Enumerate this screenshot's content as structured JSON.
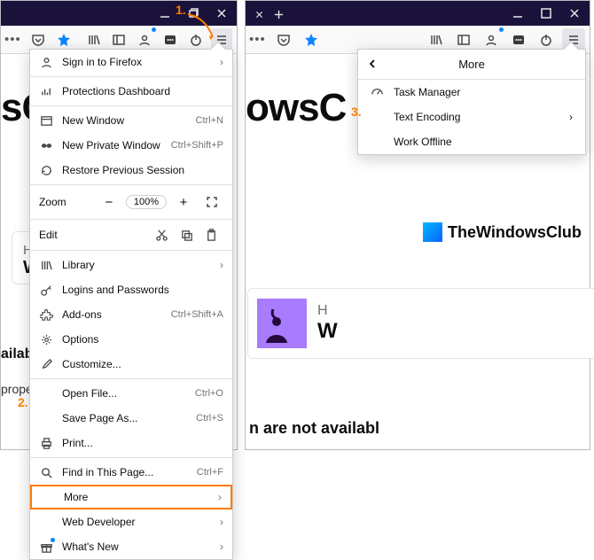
{
  "annotations": {
    "a1": "1.",
    "a2": "2.",
    "a3": "3."
  },
  "titlebar": {},
  "left": {
    "bgTitle": "sC",
    "card": {
      "h": "H",
      "w": "W"
    },
    "avail": "ailabl",
    "prop": "prope"
  },
  "right": {
    "bgTitle": "owsC",
    "twc": "TheWindowsClub",
    "card": {
      "h": "H",
      "w": "W"
    },
    "avail": "n are not availabl"
  },
  "menu": {
    "signIn": "Sign in to Firefox",
    "protections": "Protections Dashboard",
    "newWindow": {
      "label": "New Window",
      "shortcut": "Ctrl+N"
    },
    "newPrivate": {
      "label": "New Private Window",
      "shortcut": "Ctrl+Shift+P"
    },
    "restore": "Restore Previous Session",
    "zoom": {
      "label": "Zoom",
      "pct": "100%",
      "minus": "−",
      "plus": "+"
    },
    "edit": {
      "label": "Edit"
    },
    "library": "Library",
    "logins": "Logins and Passwords",
    "addons": {
      "label": "Add-ons",
      "shortcut": "Ctrl+Shift+A"
    },
    "options": "Options",
    "customize": "Customize...",
    "openFile": {
      "label": "Open File...",
      "shortcut": "Ctrl+O"
    },
    "savePage": {
      "label": "Save Page As...",
      "shortcut": "Ctrl+S"
    },
    "print": "Print...",
    "find": {
      "label": "Find in This Page...",
      "shortcut": "Ctrl+F"
    },
    "more": "More",
    "webDev": "Web Developer",
    "whatsNew": "What's New"
  },
  "submenu": {
    "title": "More",
    "taskManager": "Task Manager",
    "textEncoding": "Text Encoding",
    "workOffline": "Work Offline"
  }
}
